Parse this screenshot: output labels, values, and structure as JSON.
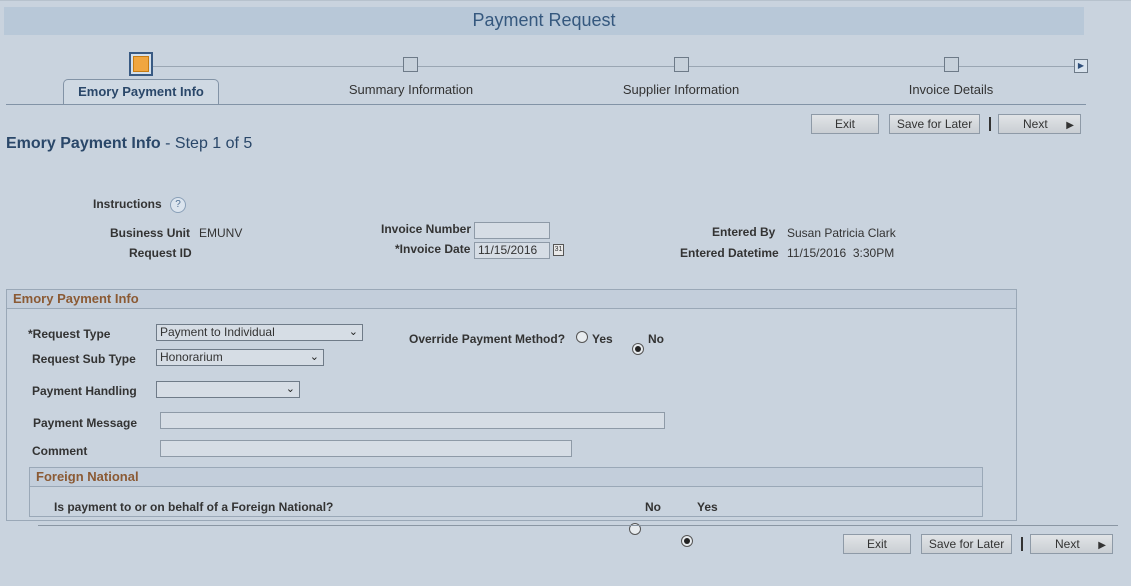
{
  "title": "Payment Request",
  "train": {
    "steps": [
      {
        "label": "Emory Payment Info",
        "active": true
      },
      {
        "label": "Summary Information",
        "active": false
      },
      {
        "label": "Supplier Information",
        "active": false
      },
      {
        "label": "Invoice Details",
        "active": false
      }
    ]
  },
  "buttons": {
    "exit": "Exit",
    "save_later": "Save for Later",
    "next": "Next"
  },
  "page_heading": {
    "title": "Emory Payment Info",
    "step": " - Step 1 of 5"
  },
  "header_fields": {
    "instructions_label": "Instructions",
    "business_unit_label": "Business Unit",
    "business_unit_value": "EMUNV",
    "request_id_label": "Request ID",
    "invoice_number_label": "Invoice Number",
    "invoice_number_value": "",
    "invoice_date_label": "*Invoice Date",
    "invoice_date_value": "11/15/2016",
    "entered_by_label": "Entered By",
    "entered_by_value": "Susan Patricia Clark",
    "entered_datetime_label": "Entered Datetime",
    "entered_datetime_value": "11/15/2016  3:30PM"
  },
  "payment_info": {
    "header": "Emory Payment Info",
    "request_type_label": "*Request Type",
    "request_type_value": "Payment to Individual",
    "request_sub_type_label": "Request Sub Type",
    "request_sub_type_value": "Honorarium",
    "payment_handling_label": "Payment Handling",
    "payment_handling_value": "",
    "payment_message_label": "Payment Message",
    "payment_message_value": "",
    "comment_label": "Comment",
    "comment_value": "",
    "override_label": "Override Payment Method?",
    "override_yes": "Yes",
    "override_no": "No",
    "override_selected": "No"
  },
  "foreign_national": {
    "header": "Foreign National",
    "question": "Is payment to or on behalf of a Foreign National?",
    "no_label": "No",
    "yes_label": "Yes",
    "selected": "Yes"
  },
  "icons": {
    "help": "help-icon",
    "calendar": "calendar-icon",
    "next_arrow": "chevron-right-icon",
    "dropdown": "chevron-down-icon"
  }
}
